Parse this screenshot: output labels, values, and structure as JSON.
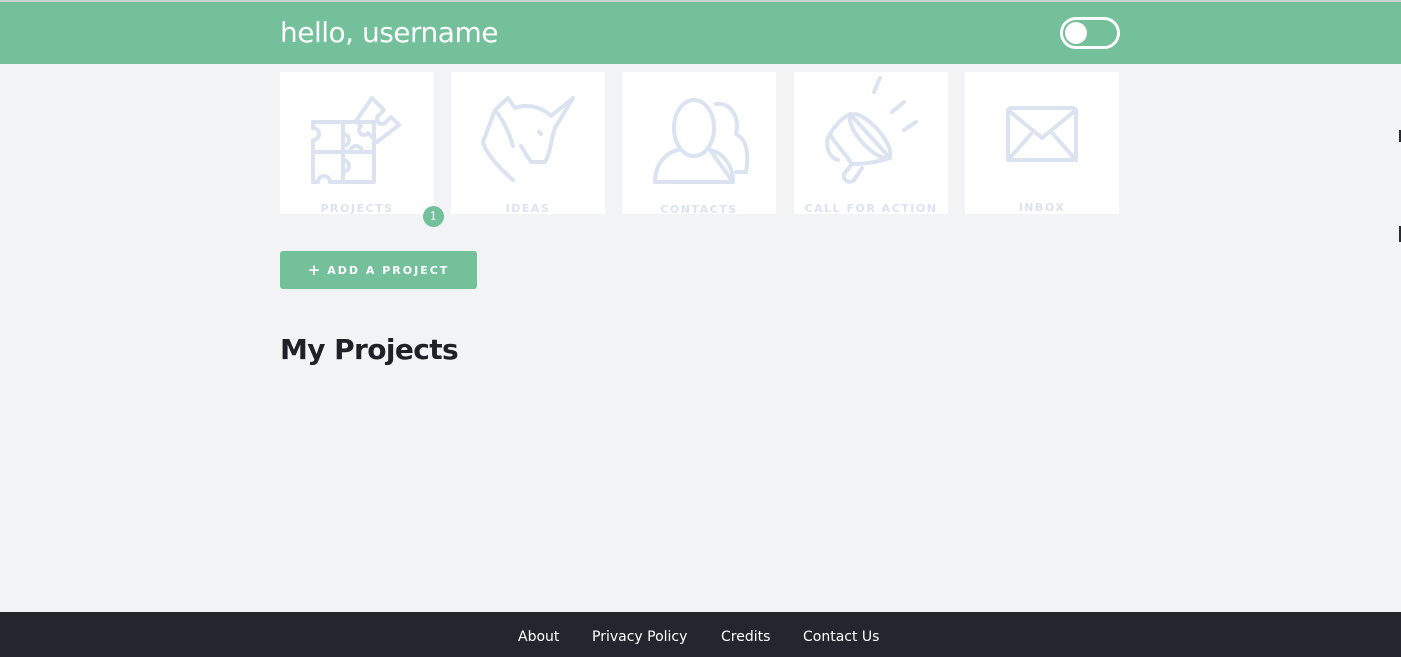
{
  "header": {
    "greeting": "hello, username",
    "theme_toggle": {
      "on": false
    }
  },
  "tiles": [
    {
      "label": "PROJECTS",
      "icon": "puzzle-icon",
      "badge": "1"
    },
    {
      "label": "IDEAS",
      "icon": "unicorn-icon"
    },
    {
      "label": "CONTACTS",
      "icon": "people-icon"
    },
    {
      "label": "CALL FOR ACTION",
      "icon": "megaphone-icon"
    },
    {
      "label": "INBOX",
      "icon": "envelope-icon"
    }
  ],
  "actions": {
    "add_project_label": "ADD A PROJECT",
    "add_icon": "plus-icon"
  },
  "main": {
    "section_title": "My Projects"
  },
  "footer": {
    "links": [
      {
        "label": "About"
      },
      {
        "label": "Privacy Policy"
      },
      {
        "label": "Credits"
      },
      {
        "label": "Contact Us"
      }
    ]
  },
  "colors": {
    "accent": "#73c09b",
    "background": "#f2f3f5",
    "footer": "#24252d",
    "icon_tint": "#dbe3f1"
  }
}
